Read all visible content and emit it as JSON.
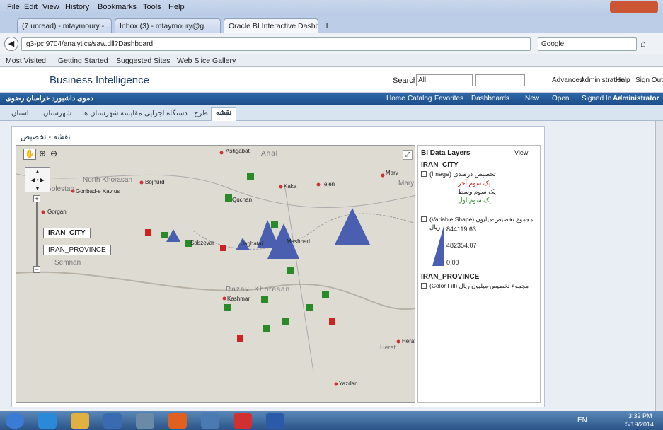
{
  "menu": [
    "File",
    "Edit",
    "View",
    "History",
    "Bookmarks",
    "Tools",
    "Help"
  ],
  "tabs": [
    "(7 unread) - mtaymoury - ...",
    "Inbox (3) - mtaymoury@g...",
    "Oracle BI Interactive Dashboard..."
  ],
  "new_tab": "+",
  "url": "g3-pc:9704/analytics/saw.dll?Dashboard",
  "search_placeholder": "Google",
  "bookmarks": [
    "Most Visited",
    "Getting Started",
    "Suggested Sites",
    "Web Slice Gallery"
  ],
  "bi": {
    "brand": "Business Intelligence",
    "search_label": "Search",
    "search_scope": "All",
    "links": [
      "Advanced",
      "Administration",
      "Help",
      "Sign Out"
    ]
  },
  "dashbar": {
    "title": "دموی داشبورد خراسان رضوی",
    "items": [
      "Home",
      "Catalog",
      "Favorites",
      "Dashboards",
      "New",
      "Open",
      "Signed In As"
    ],
    "user": "Administrator"
  },
  "subtabs": [
    "نقشه",
    "طرح",
    "دستگاه اجرایی",
    "مقایسه شهرستان ها",
    "شهرستان",
    "استان"
  ],
  "panel_title": "نقشه - تخصیص",
  "map": {
    "layer_labels": [
      "IRAN_CITY",
      "IRAN_PROVINCE"
    ],
    "places": [
      "Ashgabat",
      "Ahal",
      "Mary",
      "Mary",
      "Tejen",
      "North Khorasan",
      "Bojnurd",
      "Golestan",
      "Gonbad-e Kav us",
      "Gorgan",
      "Semnan",
      "Razavi Khorasan",
      "Kashmar",
      "Herat",
      "Herat",
      "Yazdan",
      "Kaka",
      "Mashhad",
      "Sabzevar",
      "Quchan",
      "Jaghatai"
    ]
  },
  "layers": {
    "title": "BI Data Layers",
    "view": "View",
    "city": "IRAN_CITY",
    "image_label": "(Image) تخصیص درصدی",
    "legend": [
      "یک سوم آخر",
      "یک سوم وسط",
      "یک سوم اول"
    ],
    "shape_label": "(Variable Shape) مجموع تخصیص-میلیون ریال",
    "values": [
      "844119.63",
      "482354.07",
      "0.00"
    ],
    "province": "IRAN_PROVINCE",
    "fill_label": "(Color Fill) مجموع تخصیص-میلیون ریال"
  },
  "taskbar": {
    "lang": "EN",
    "time": "3:32 PM",
    "date": "5/19/2014"
  },
  "colors": {
    "accent": "#1d4d87",
    "triangle": "#4b5fb0",
    "green": "#2a8a2a",
    "red": "#cc2222"
  }
}
